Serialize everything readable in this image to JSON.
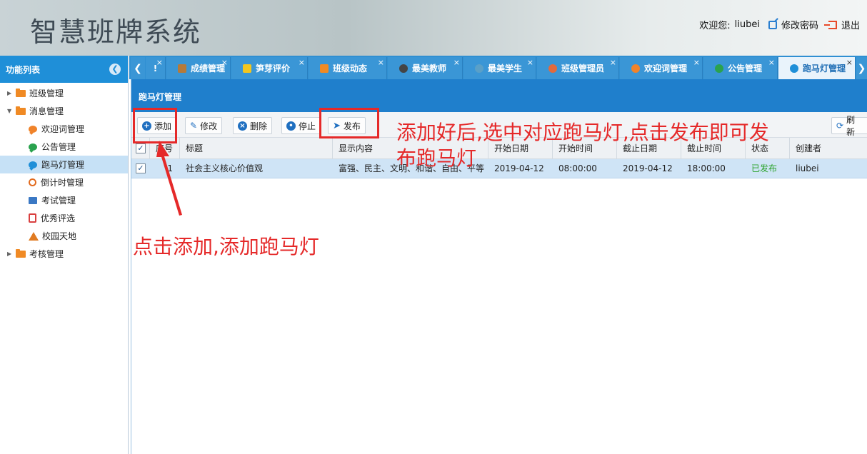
{
  "header": {
    "title": "智慧班牌系统",
    "welcome": "欢迎您:",
    "username": "liubei",
    "change_password": "修改密码",
    "logout": "退出"
  },
  "sidebar": {
    "title": "功能列表",
    "items": [
      {
        "label": "班级管理"
      },
      {
        "label": "消息管理"
      },
      {
        "label": "欢迎词管理"
      },
      {
        "label": "公告管理"
      },
      {
        "label": "跑马灯管理"
      },
      {
        "label": "倒计时管理"
      },
      {
        "label": "考试管理"
      },
      {
        "label": "优秀评选"
      },
      {
        "label": "校园天地"
      },
      {
        "label": "考核管理"
      }
    ]
  },
  "tabs": [
    {
      "label": "!"
    },
    {
      "label": "成绩管理"
    },
    {
      "label": "笋芽评价"
    },
    {
      "label": "班级动态"
    },
    {
      "label": "最美教师"
    },
    {
      "label": "最美学生"
    },
    {
      "label": "班级管理员"
    },
    {
      "label": "欢迎词管理"
    },
    {
      "label": "公告管理"
    },
    {
      "label": "跑马灯管理"
    }
  ],
  "panel": {
    "title": "跑马灯管理"
  },
  "toolbar": {
    "add": "添加",
    "edit": "修改",
    "delete": "删除",
    "stop": "停止",
    "publish": "发布",
    "refresh": "刷新"
  },
  "table": {
    "columns": [
      "序号",
      "标题",
      "显示内容",
      "开始日期",
      "开始时间",
      "截止日期",
      "截止时间",
      "状态",
      "创建者"
    ],
    "rows": [
      {
        "no": "1",
        "title": "社会主义核心价值观",
        "content": "富强、民主、文明、和谐、自由、平等、公正、法治、爱国、敬业、诚信、友善",
        "start_date": "2019-04-12",
        "start_time": "08:00:00",
        "end_date": "2019-04-12",
        "end_time": "18:00:00",
        "status": "已发布",
        "creator": "liubei"
      }
    ]
  },
  "annotations": {
    "add_hint": "点击添加,添加跑马灯",
    "publish_hint_line1": "添加好后,选中对应跑马灯,点击发布即可发",
    "publish_hint_line2": "布跑马灯"
  },
  "colors": {
    "accent": "#1f8fd8",
    "annotation": "#e52929",
    "status_published": "#2aa22a"
  }
}
